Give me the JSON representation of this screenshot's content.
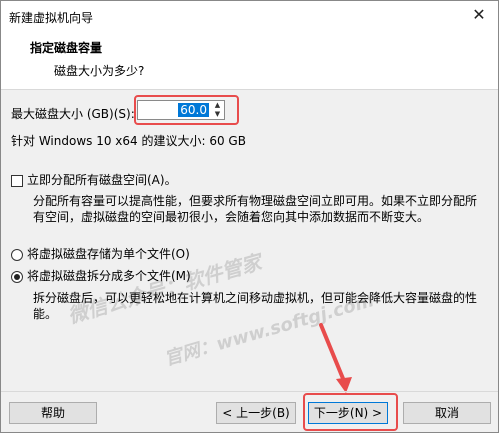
{
  "window": {
    "title": "新建虚拟机向导",
    "close_glyph": "✕"
  },
  "header": {
    "heading": "指定磁盘容量",
    "subheading": "磁盘大小为多少?"
  },
  "disk": {
    "size_label": "最大磁盘大小 (GB)(S):",
    "size_value": "60.0",
    "recommend_text": "针对 Windows 10 x64 的建议大小: 60 GB"
  },
  "allocate": {
    "label": "立即分配所有磁盘空间(A)。",
    "checked": false,
    "description": "分配所有容量可以提高性能，但要求所有物理磁盘空间立即可用。如果不立即分配所有空间，虚拟磁盘的空间最初很小，会随着您向其中添加数据而不断变大。"
  },
  "storage": {
    "single_label": "将虚拟磁盘存储为单个文件(O)",
    "multi_label": "将虚拟磁盘拆分成多个文件(M)",
    "selected": "multi",
    "multi_description": "拆分磁盘后，可以更轻松地在计算机之间移动虚拟机，但可能会降低大容量磁盘的性能。"
  },
  "buttons": {
    "help": "帮助",
    "back": "< 上一步(B)",
    "next": "下一步(N) >",
    "cancel": "取消"
  },
  "watermark": {
    "line1": "微信公众号：软件管家",
    "line2": "官网：www.softgj.com"
  },
  "colors": {
    "highlight": "#e84c4c",
    "selection": "#0078d7"
  }
}
